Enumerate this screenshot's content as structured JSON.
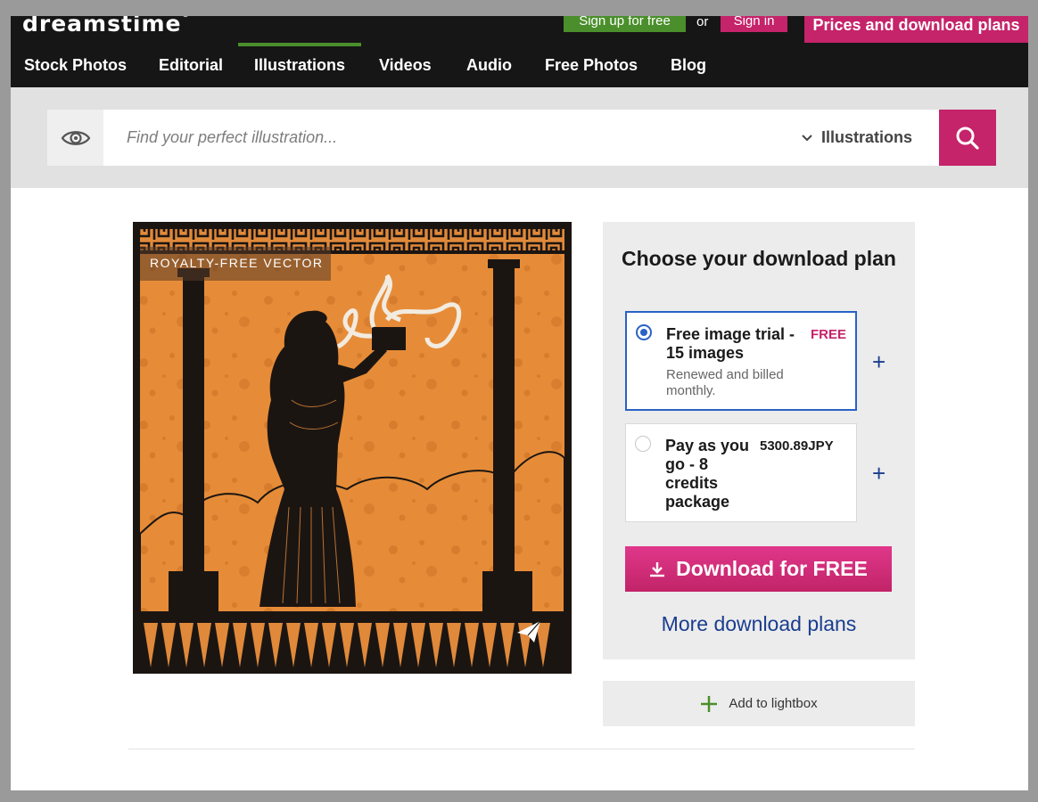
{
  "header": {
    "logo": "dreamstime",
    "logo_mark": "®",
    "signup_label": "Sign up for free",
    "or_label": "or",
    "signin_label": "Sign in",
    "prices_label": "Prices and download plans"
  },
  "nav": {
    "items": [
      {
        "label": "Stock Photos"
      },
      {
        "label": "Editorial"
      },
      {
        "label": "Illustrations",
        "active": true
      },
      {
        "label": "Videos"
      },
      {
        "label": "Audio"
      },
      {
        "label": "Free Photos"
      },
      {
        "label": "Blog"
      }
    ]
  },
  "search": {
    "placeholder": "Find your perfect illustration...",
    "category": "Illustrations"
  },
  "image": {
    "badge": "ROYALTY-FREE VECTOR"
  },
  "panel": {
    "title": "Choose your download plan",
    "plans": [
      {
        "name": "Free image trial - 15 images",
        "price": "FREE",
        "sub": "Renewed and billed monthly.",
        "selected": true
      },
      {
        "name": "Pay as you go - 8 credits package",
        "price": "5300.89JPY",
        "sub": "",
        "selected": false
      }
    ],
    "download_label": "Download for FREE",
    "more_plans_label": "More download plans"
  },
  "lightbox": {
    "label": "Add to lightbox"
  },
  "colors": {
    "brand_pink": "#c5236a",
    "brand_green": "#4a8f2b",
    "link_blue": "#1a3d8f",
    "selected_blue": "#2a62c6"
  }
}
